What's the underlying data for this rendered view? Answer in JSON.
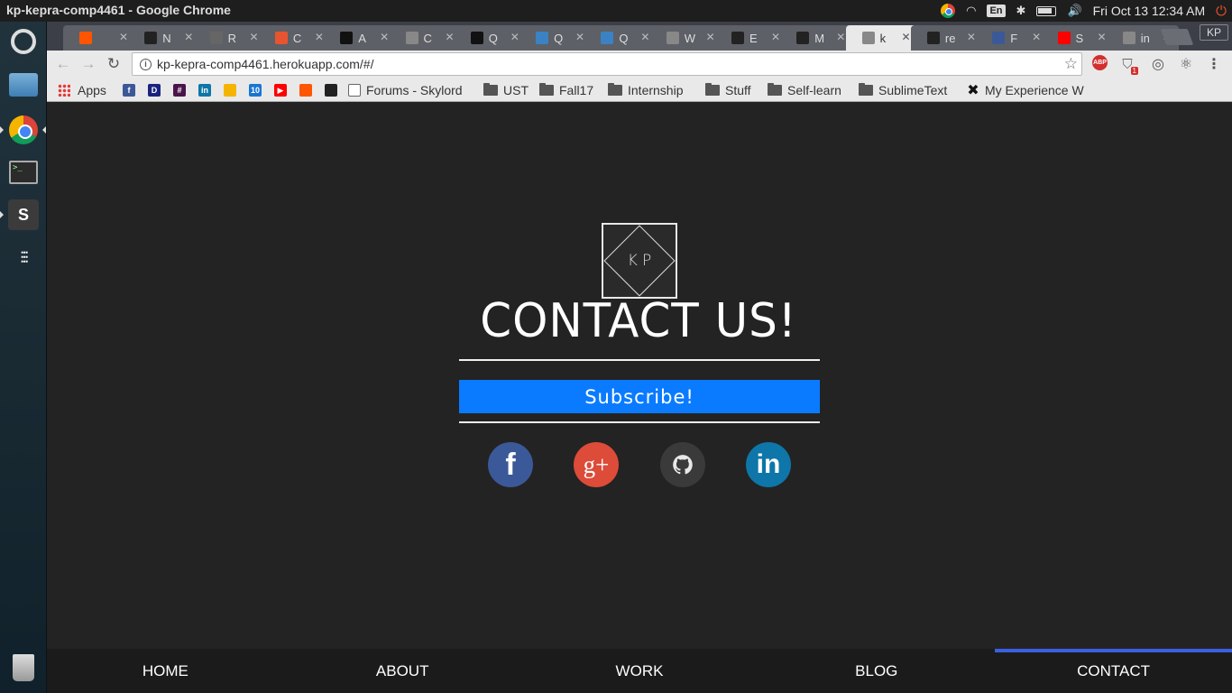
{
  "window": {
    "title": "kp-kepra-comp4461 - Google Chrome"
  },
  "tray": {
    "language": "En",
    "clock": "Fri Oct 13 12:34 AM"
  },
  "browser": {
    "tabs": [
      {
        "label": "",
        "color": "#ff5500"
      },
      {
        "label": "N",
        "color": "#222222"
      },
      {
        "label": "R",
        "color": "#666666"
      },
      {
        "label": "C",
        "color": "#e8542f"
      },
      {
        "label": "A",
        "color": "#111111"
      },
      {
        "label": "C",
        "color": "#888888"
      },
      {
        "label": "Q",
        "color": "#111111"
      },
      {
        "label": "Q",
        "color": "#3b82c4"
      },
      {
        "label": "Q",
        "color": "#3b82c4"
      },
      {
        "label": "W",
        "color": "#888888"
      },
      {
        "label": "E",
        "color": "#222222"
      },
      {
        "label": "M",
        "color": "#222222"
      },
      {
        "label": "k",
        "color": "#888888"
      },
      {
        "label": "re",
        "color": "#222222"
      },
      {
        "label": "F",
        "color": "#3b5998"
      },
      {
        "label": "S",
        "color": "#ff0000"
      },
      {
        "label": "in",
        "color": "#888888"
      }
    ],
    "profile": "KP",
    "url": "kp-kepra-comp4461.herokuapp.com/#/",
    "extensions": {
      "abp": "ABP",
      "shield_badge": "1"
    },
    "bookmarks": [
      {
        "label": "Apps",
        "type": "apps"
      },
      {
        "label": "",
        "type": "icon",
        "icon": "f",
        "color": "#3b5998"
      },
      {
        "label": "",
        "type": "icon",
        "icon": "D",
        "color": "#1a237e"
      },
      {
        "label": "",
        "type": "icon",
        "icon": "#",
        "color": "#4a154b"
      },
      {
        "label": "",
        "type": "icon",
        "icon": "in",
        "color": "#0e76a8"
      },
      {
        "label": "",
        "type": "icon",
        "icon": "",
        "color": "#f4b400"
      },
      {
        "label": "",
        "type": "icon",
        "icon": "10",
        "color": "#1976d2"
      },
      {
        "label": "",
        "type": "icon",
        "icon": "▶",
        "color": "#ff0000"
      },
      {
        "label": "",
        "type": "icon",
        "icon": "",
        "color": "#ff5500"
      },
      {
        "label": "",
        "type": "icon",
        "icon": "",
        "color": "#222222"
      },
      {
        "label": "Forums - Skylord",
        "type": "page"
      },
      {
        "label": "UST",
        "type": "folder"
      },
      {
        "label": "Fall17",
        "type": "folder"
      },
      {
        "label": "Internship",
        "type": "folder"
      },
      {
        "label": "Stuff",
        "type": "folder"
      },
      {
        "label": "Self-learn",
        "type": "folder"
      },
      {
        "label": "SublimeText",
        "type": "folder"
      },
      {
        "label": "My Experience W",
        "type": "x"
      }
    ]
  },
  "page": {
    "logo": "KP",
    "title": "CONTACT US!",
    "subscribe_label": "Subscribe!",
    "social": {
      "facebook": "f",
      "google_plus": "g+",
      "linkedin": "in"
    },
    "nav": [
      {
        "label": "HOME",
        "active": false
      },
      {
        "label": "ABOUT",
        "active": false
      },
      {
        "label": "WORK",
        "active": false
      },
      {
        "label": "BLOG",
        "active": false
      },
      {
        "label": "CONTACT",
        "active": true
      }
    ],
    "colors": {
      "accent": "#0a7bff",
      "nav_active": "#3a5fe0",
      "background": "#232323"
    }
  }
}
